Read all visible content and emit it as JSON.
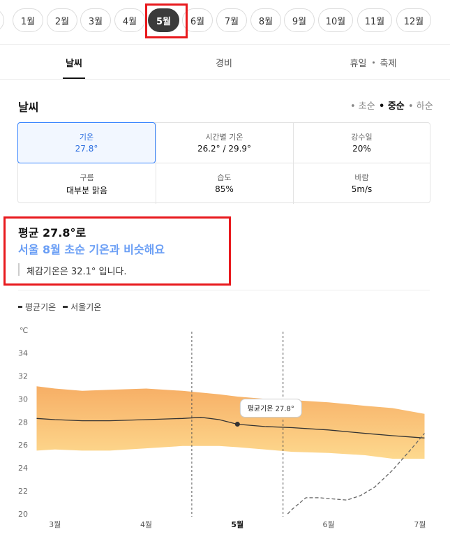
{
  "months": {
    "items": [
      "1월",
      "2월",
      "3월",
      "4월",
      "5월",
      "6월",
      "7월",
      "8월",
      "9월",
      "10월",
      "11월",
      "12월"
    ],
    "selected": "5월"
  },
  "tabs": {
    "weather": "날씨",
    "cost": "경비",
    "holiday": "휴일",
    "festival": "축제"
  },
  "weather_section": {
    "title": "날씨",
    "periods": [
      "초순",
      "중순",
      "하순"
    ],
    "selected_period": "중순"
  },
  "stats": {
    "temp_label": "기온",
    "temp_value": "27.8°",
    "hourly_label": "시간별 기온",
    "hourly_value": "26.2° / 29.9°",
    "rain_label": "강수일",
    "rain_value": "20%",
    "cloud_label": "구름",
    "cloud_value": "대부분 맑음",
    "humidity_label": "습도",
    "humidity_value": "85%",
    "wind_label": "바람",
    "wind_value": "5m/s"
  },
  "summary": {
    "line1": "평균 27.8°로",
    "line2": "서울 8월 초순 기온과 비슷해요",
    "line3": "체감기온은 32.1° 입니다."
  },
  "legend": {
    "avg": "평균기온",
    "seoul": "서울기온"
  },
  "colors": {
    "accent": "#2d6fe0",
    "highlight_text": "#6a9ef5",
    "band_top": "#f5a04a",
    "band_bottom": "#fdd27a",
    "annotation_border": "#e8191d"
  },
  "chart_data": {
    "type": "area",
    "ylabel": "℃",
    "yticks": [
      20,
      22,
      24,
      26,
      28,
      30,
      32,
      34
    ],
    "ylim": [
      20,
      35
    ],
    "xticks": [
      "3월",
      "4월",
      "5월",
      "6월",
      "7월"
    ],
    "xticks_pos": [
      3,
      4,
      5,
      6,
      7
    ],
    "xlim": [
      2.75,
      7.1
    ],
    "bold_tick": "5월",
    "dividers": [
      4.5,
      5.5
    ],
    "marker": {
      "x": 5.0,
      "y": 27.8,
      "label": "평균기온 27.8°"
    },
    "band_upper": {
      "x": [
        2.8,
        3.0,
        3.3,
        3.6,
        4.0,
        4.4,
        4.8,
        5.0,
        5.3,
        5.6,
        6.0,
        6.4,
        6.7,
        7.05
      ],
      "y": [
        31.1,
        30.9,
        30.7,
        30.8,
        30.9,
        30.7,
        30.4,
        30.2,
        30.0,
        29.9,
        29.7,
        29.4,
        29.2,
        28.7
      ]
    },
    "band_lower": {
      "x": [
        2.8,
        3.0,
        3.3,
        3.6,
        4.0,
        4.4,
        4.8,
        5.0,
        5.3,
        5.6,
        6.0,
        6.4,
        6.7,
        7.05
      ],
      "y": [
        25.5,
        25.6,
        25.5,
        25.5,
        25.7,
        25.9,
        25.9,
        25.8,
        25.6,
        25.4,
        25.3,
        25.1,
        24.8,
        24.8
      ]
    },
    "series": [
      {
        "name": "평균기온",
        "style": "solid",
        "x": [
          2.8,
          3.0,
          3.3,
          3.6,
          4.0,
          4.4,
          4.6,
          4.8,
          5.0,
          5.3,
          5.6,
          6.0,
          6.4,
          6.7,
          7.05
        ],
        "y": [
          28.3,
          28.2,
          28.1,
          28.1,
          28.2,
          28.3,
          28.4,
          28.2,
          27.8,
          27.6,
          27.5,
          27.3,
          27.0,
          26.8,
          26.6
        ]
      },
      {
        "name": "서울기온",
        "style": "dashed",
        "x": [
          5.55,
          5.6,
          5.75,
          5.9,
          6.05,
          6.2,
          6.35,
          6.5,
          6.7,
          6.9,
          7.05
        ],
        "y": [
          20.0,
          20.4,
          21.4,
          21.4,
          21.3,
          21.2,
          21.6,
          22.3,
          23.8,
          25.6,
          27.0
        ]
      }
    ]
  }
}
